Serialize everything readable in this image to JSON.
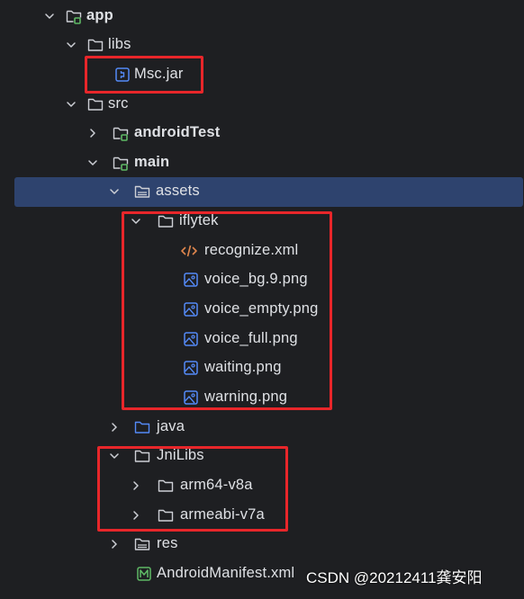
{
  "tree": [
    {
      "id": "app",
      "label": "app",
      "icon": "module-folder-icon",
      "expanded": true,
      "bold": true
    },
    {
      "id": "libs",
      "label": "libs",
      "icon": "folder-icon",
      "expanded": true,
      "bold": false
    },
    {
      "id": "msc-jar",
      "label": "Msc.jar",
      "icon": "jar-file-icon",
      "bold": false
    },
    {
      "id": "src",
      "label": "src",
      "icon": "folder-icon",
      "expanded": true,
      "bold": false
    },
    {
      "id": "androidtest",
      "label": "androidTest",
      "icon": "module-folder-icon",
      "expanded": false,
      "bold": true
    },
    {
      "id": "main",
      "label": "main",
      "icon": "module-folder-icon",
      "expanded": true,
      "bold": true
    },
    {
      "id": "assets",
      "label": "assets",
      "icon": "resource-folder-icon",
      "expanded": true,
      "bold": false,
      "selected": true
    },
    {
      "id": "iflytek",
      "label": "iflytek",
      "icon": "folder-icon",
      "expanded": true,
      "bold": false
    },
    {
      "id": "recognize-xml",
      "label": "recognize.xml",
      "icon": "xml-file-icon",
      "bold": false
    },
    {
      "id": "voice-bg-png",
      "label": "voice_bg.9.png",
      "icon": "image-file-icon",
      "bold": false
    },
    {
      "id": "voice-empty-png",
      "label": "voice_empty.png",
      "icon": "image-file-icon",
      "bold": false
    },
    {
      "id": "voice-full-png",
      "label": "voice_full.png",
      "icon": "image-file-icon",
      "bold": false
    },
    {
      "id": "waiting-png",
      "label": "waiting.png",
      "icon": "image-file-icon",
      "bold": false
    },
    {
      "id": "warning-png",
      "label": "warning.png",
      "icon": "image-file-icon",
      "bold": false
    },
    {
      "id": "java",
      "label": "java",
      "icon": "source-folder-icon",
      "expanded": false,
      "bold": false
    },
    {
      "id": "jnilibs",
      "label": "JniLibs",
      "icon": "folder-icon",
      "expanded": true,
      "bold": false
    },
    {
      "id": "arm64-v8a",
      "label": "arm64-v8a",
      "icon": "folder-icon",
      "expanded": false,
      "bold": false
    },
    {
      "id": "armeabi-v7a",
      "label": "armeabi-v7a",
      "icon": "folder-icon",
      "expanded": false,
      "bold": false
    },
    {
      "id": "res",
      "label": "res",
      "icon": "resource-folder-icon",
      "expanded": false,
      "bold": false
    },
    {
      "id": "androidmanifest",
      "label": "AndroidManifest.xml",
      "icon": "manifest-file-icon",
      "bold": false
    }
  ],
  "watermark": "CSDN @20212411龚安阳",
  "colors": {
    "background": "#1e1f22",
    "selection": "#2e436e",
    "highlight_box": "#e8262a",
    "text": "#dfe1e5",
    "folder_icon": "#ced0d6",
    "module_badge": "#5fb865",
    "source_folder": "#548af7",
    "image_icon": "#548af7",
    "xml_icon": "#e0864d",
    "manifest_icon": "#5fb865"
  }
}
